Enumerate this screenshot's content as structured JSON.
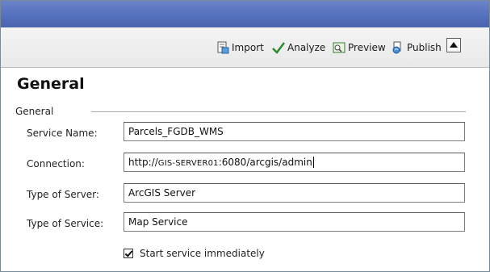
{
  "toolbar": {
    "import_label": "Import",
    "analyze_label": "Analyze",
    "preview_label": "Preview",
    "publish_label": "Publish"
  },
  "main": {
    "title": "General",
    "section_label": "General",
    "fields": [
      {
        "label": "Service Name:",
        "value": "Parcels_FGDB_WMS"
      },
      {
        "label": "Connection:",
        "value_prefix": "http://",
        "value_host": "GIS-SERVER01",
        "value_suffix": ":6080/arcgis/admin"
      },
      {
        "label": "Type of Server:",
        "value": "ArcGIS Server"
      },
      {
        "label": "Type of Service:",
        "value": "Map Service"
      }
    ],
    "start_service": {
      "label": "Start service immediately",
      "checked": true
    }
  },
  "icons": {
    "import": "import-icon",
    "analyze": "checkmark-icon",
    "preview": "preview-icon",
    "publish": "publish-icon",
    "collapse": "triangle-up-icon"
  },
  "colors": {
    "titlebar": "#5571bd",
    "toolbar": "#eeeeee",
    "analyze_check": "#2c8a2c"
  }
}
